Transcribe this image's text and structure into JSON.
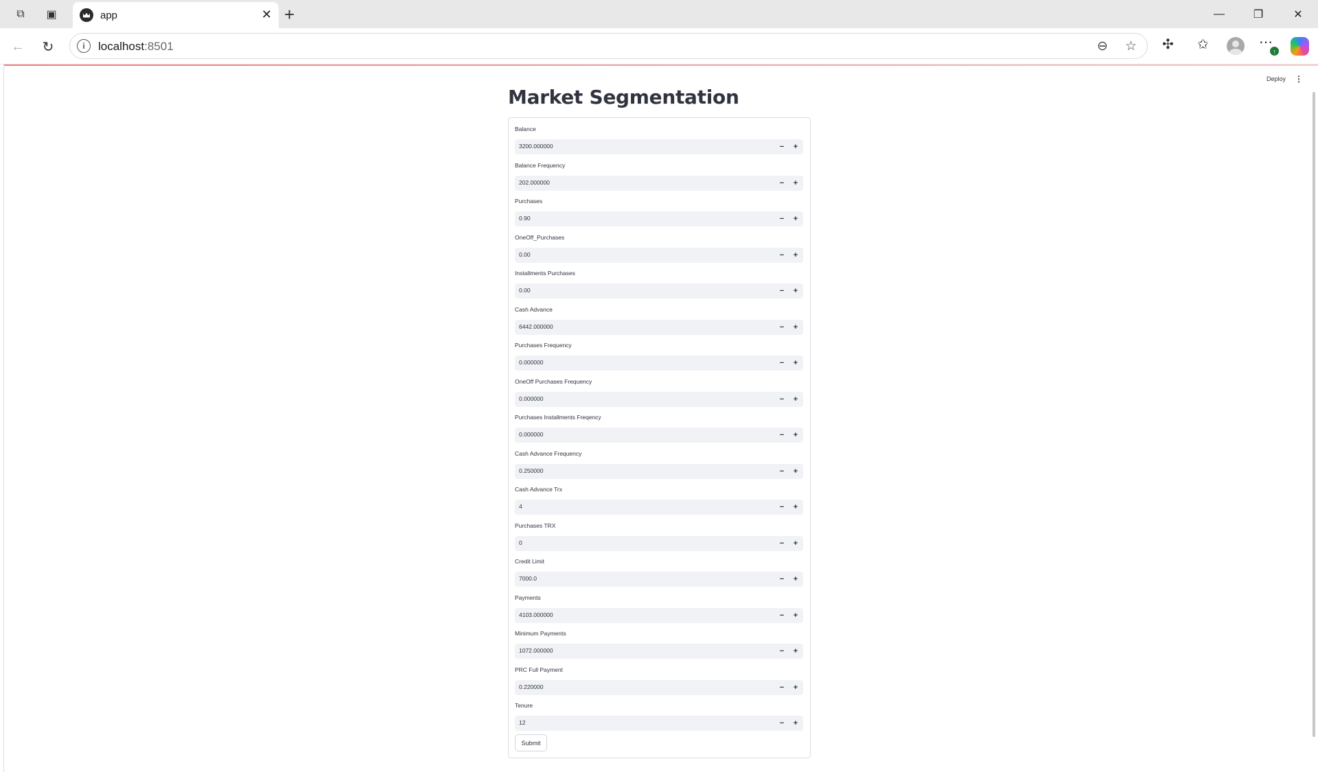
{
  "browser": {
    "tab_title": "app",
    "url_host": "localhost",
    "url_port": ":8501"
  },
  "app": {
    "deploy_label": "Deploy",
    "title": "Market Segmentation",
    "submit_label": "Submit",
    "fields": [
      {
        "label": "Balance",
        "value": "3200.000000"
      },
      {
        "label": "Balance Frequency",
        "value": "202.000000"
      },
      {
        "label": "Purchases",
        "value": "0.90"
      },
      {
        "label": "OneOff_Purchases",
        "value": "0.00"
      },
      {
        "label": "Installments Purchases",
        "value": "0.00"
      },
      {
        "label": "Cash Advance",
        "value": "6442.000000"
      },
      {
        "label": "Purchases Frequency",
        "value": "0.000000"
      },
      {
        "label": "OneOff Purchases Frequency",
        "value": "0.000000"
      },
      {
        "label": "Purchases Installments Freqency",
        "value": "0.000000"
      },
      {
        "label": "Cash Advance Frequency",
        "value": "0.250000"
      },
      {
        "label": "Cash Advance Trx",
        "value": "4"
      },
      {
        "label": "Purchases TRX",
        "value": "0"
      },
      {
        "label": "Credit Limit",
        "value": "7000.0"
      },
      {
        "label": "Payments",
        "value": "4103.000000"
      },
      {
        "label": "Minimum Payments",
        "value": "1072.000000"
      },
      {
        "label": "PRC Full Payment",
        "value": "0.220000"
      },
      {
        "label": "Tenure",
        "value": "12"
      }
    ]
  }
}
